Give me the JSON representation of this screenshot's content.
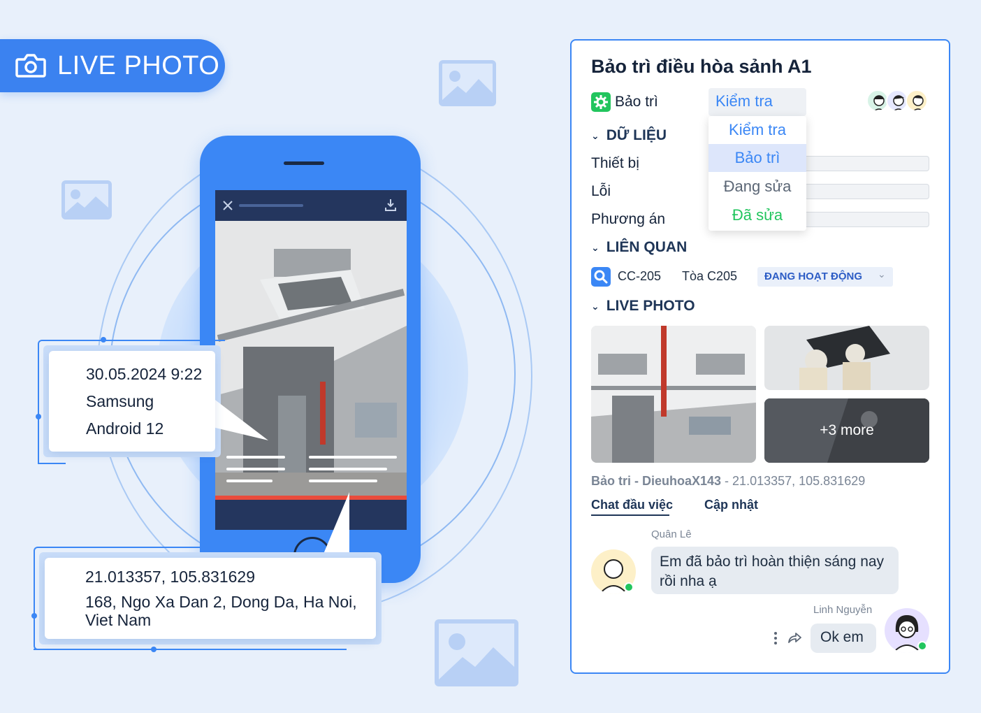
{
  "badge": {
    "label": "LIVE PHOTO"
  },
  "info_card_1": {
    "line1": "30.05.2024 9:22",
    "line2": "Samsung",
    "line3": "Android 12"
  },
  "info_card_2": {
    "line1": "21.013357, 105.831629",
    "line2": "168, Ngo Xa Dan 2, Dong Da, Ha Noi, Viet Nam"
  },
  "panel": {
    "title": "Bảo trì điều hòa sảnh A1",
    "category": "Bảo trì",
    "status_selected": "Kiểm tra",
    "status_options": [
      {
        "label": "Kiểm tra",
        "color": "#3b87f5"
      },
      {
        "label": "Bảo trì",
        "color": "#3b87f5"
      },
      {
        "label": "Đang sửa",
        "color": "#5b6675"
      },
      {
        "label": "Đã sửa",
        "color": "#22c55e"
      }
    ],
    "section_data": "DỮ LIỆU",
    "fields": [
      "Thiết bị",
      "Lỗi",
      "Phương án"
    ],
    "section_related": "LIÊN QUAN",
    "related": {
      "code": "CC-205",
      "name": "Tòa C205",
      "status": "ĐANG HOẠT ĐỘNG"
    },
    "section_photo": "LIVE PHOTO",
    "more_label": "+3 more",
    "photo_caption_bold": "Bảo tri - DieuhoaX143",
    "photo_caption_rest": " - 21.013357, 105.831629",
    "tabs": [
      "Chat đầu việc",
      "Cập nhật"
    ],
    "messages": [
      {
        "author": "Quân Lê",
        "text": "Em đã bảo trì hoàn thiện sáng nay rồi nha ạ"
      },
      {
        "author": "Linh Nguyễn",
        "text": "Ok em"
      }
    ]
  },
  "colors": {
    "accent": "#3b87f5",
    "online": "#22c55e",
    "category_icon": "#22c55e"
  }
}
